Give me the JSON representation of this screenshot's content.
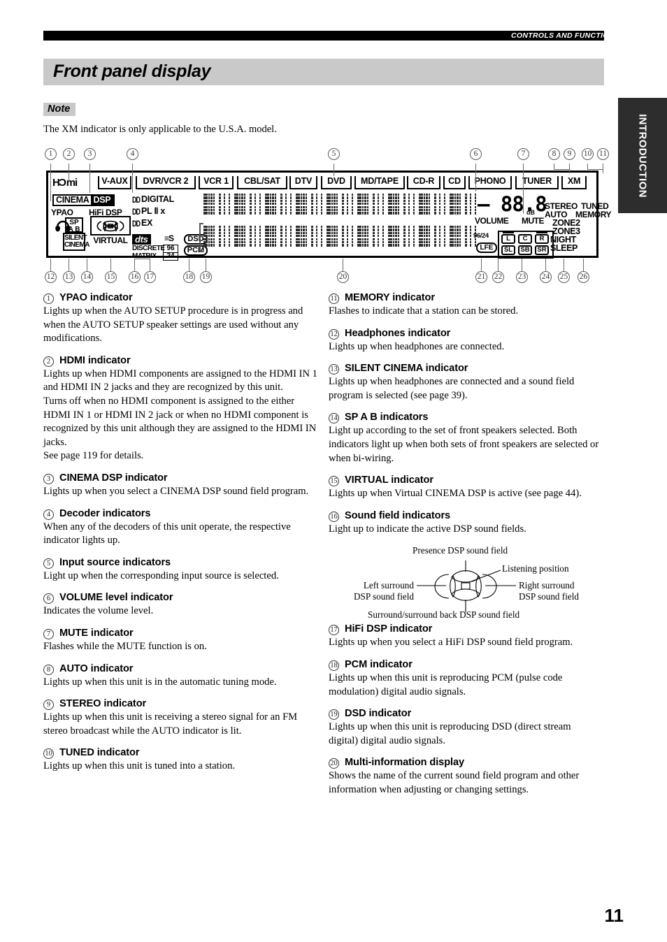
{
  "header": {
    "running_head": "CONTROLS AND FUNCTIONS",
    "title": "Front panel display",
    "side_tab": "INTRODUCTION"
  },
  "note": {
    "label": "Note",
    "text": "The XM indicator is only applicable to the U.S.A. model."
  },
  "figure": {
    "top_callouts": [
      "1",
      "2",
      "3",
      "4",
      "5",
      "6",
      "7",
      "8",
      "9",
      "10",
      "11"
    ],
    "bottom_callouts": [
      "12",
      "13",
      "14",
      "15",
      "16",
      "17",
      "18",
      "19",
      "20",
      "21",
      "22",
      "23",
      "24",
      "25",
      "26"
    ],
    "hdmi": "HƊmi",
    "cinema": "CINEMA",
    "dsp": "DSP",
    "ypao": "YPAO",
    "hifi_dsp": "HiFi DSP",
    "sp": "SP",
    "sp_ab": "A B",
    "silent": "SILENT",
    "cinema2": "CINEMA",
    "virtual": "VIRTUAL",
    "sources": [
      "V-AUX",
      "DVR/VCR 2",
      "VCR 1",
      "CBL/SAT",
      "DTV",
      "DVD",
      "MD/TAPE",
      "CD-R",
      "CD",
      "PHONO",
      "TUNER",
      "XM"
    ],
    "decoders": [
      "DIGITAL",
      "PL Ⅱ x",
      "EX"
    ],
    "dts": "dts",
    "es": "ES",
    "discrete": "DISCRETE",
    "matrix": "MATRIX",
    "num96": "96",
    "num24": "24",
    "dsd": "DSD",
    "pcm": "PCM",
    "volume_value": "– 88.8",
    "db": "dB",
    "volume_label": "VOLUME",
    "mute": "MUTE",
    "stereo": "STEREO",
    "tuned": "TUNED",
    "auto": "AUTO",
    "memory": "MEMORY",
    "zone2": "ZONE2",
    "zone3": "ZONE3",
    "night": "NIGHT",
    "sleep": "SLEEP",
    "rate_9624": "96/24",
    "lfe": "LFE",
    "channels": [
      "L",
      "C",
      "R",
      "SL",
      "SB",
      "SR"
    ]
  },
  "sound_field_figure": {
    "presence": "Presence DSP sound field",
    "listening": "Listening position",
    "left_surround_1": "Left surround",
    "left_surround_2": "DSP sound field",
    "right_surround_1": "Right surround",
    "right_surround_2": "DSP sound field",
    "surround_back": "Surround/surround back DSP sound field"
  },
  "entries_left": [
    {
      "num": "1",
      "title": "YPAO indicator",
      "body": "Lights up when the AUTO SETUP procedure is in progress and when the AUTO SETUP speaker settings are used without any modifications."
    },
    {
      "num": "2",
      "title": "HDMI indicator",
      "body": "Lights up when HDMI components are assigned to the HDMI IN 1 and HDMI IN 2 jacks and they are recognized by this unit.\nTurns off when no HDMI component is assigned to the either HDMI IN 1 or HDMI IN 2 jack or when no HDMI component is recognized by this unit although they are assigned to the HDMI IN jacks.\nSee page 119 for details."
    },
    {
      "num": "3",
      "title": "CINEMA DSP indicator",
      "body": "Lights up when you select a CINEMA DSP sound field program."
    },
    {
      "num": "4",
      "title": "Decoder indicators",
      "body": "When any of the decoders of this unit operate, the respective indicator lights up."
    },
    {
      "num": "5",
      "title": "Input source indicators",
      "body": "Light up when the corresponding input source is selected."
    },
    {
      "num": "6",
      "title": "VOLUME level indicator",
      "body": "Indicates the volume level."
    },
    {
      "num": "7",
      "title": "MUTE indicator",
      "body": "Flashes while the MUTE function is on."
    },
    {
      "num": "8",
      "title": "AUTO indicator",
      "body": "Lights up when this unit is in the automatic tuning mode."
    },
    {
      "num": "9",
      "title": "STEREO indicator",
      "body": "Lights up when this unit is receiving a stereo signal for an FM stereo broadcast while the AUTO indicator is lit."
    },
    {
      "num": "10",
      "title": "TUNED indicator",
      "body": "Lights up when this unit is tuned into a station."
    }
  ],
  "entries_right": [
    {
      "num": "11",
      "title": "MEMORY indicator",
      "body": "Flashes to indicate that a station can be stored."
    },
    {
      "num": "12",
      "title": "Headphones indicator",
      "body": "Lights up when headphones are connected."
    },
    {
      "num": "13",
      "title": "SILENT CINEMA indicator",
      "body": "Lights up when headphones are connected and a sound field program is selected (see page 39)."
    },
    {
      "num": "14",
      "title": "SP A B indicators",
      "body": "Light up according to the set of front speakers selected. Both indicators light up when both sets of front speakers are selected or when bi-wiring."
    },
    {
      "num": "15",
      "title": "VIRTUAL indicator",
      "body": "Lights up when Virtual CINEMA DSP is active (see page 44)."
    },
    {
      "num": "16",
      "title": "Sound field indicators",
      "body": "Light up to indicate the active DSP sound fields."
    },
    {
      "num": "17",
      "title": "HiFi DSP indicator",
      "body": "Lights up when you select a HiFi DSP sound field program."
    },
    {
      "num": "18",
      "title": "PCM indicator",
      "body": "Lights up when this unit is reproducing PCM (pulse code modulation) digital audio signals."
    },
    {
      "num": "19",
      "title": "DSD indicator",
      "body": "Lights up when this unit is reproducing DSD (direct stream digital) digital audio signals."
    },
    {
      "num": "20",
      "title": "Multi-information display",
      "body": "Shows the name of the current sound field program and other information when adjusting or changing settings."
    }
  ],
  "page_number": "11"
}
